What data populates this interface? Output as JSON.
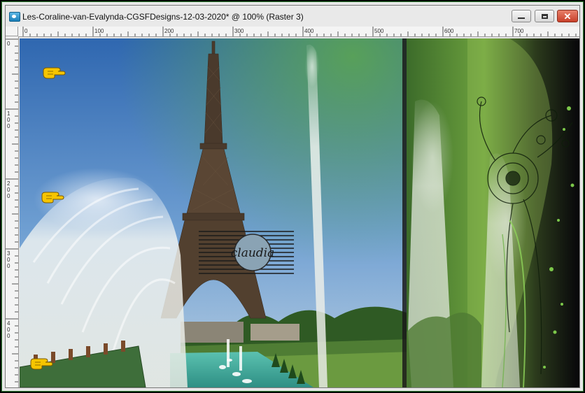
{
  "window": {
    "title": "Les-Coraline-van-Evalynda-CGSFDesigns-12-03-2020* @ 100% (Raster 3)",
    "icon": "psp-image-icon",
    "controls": {
      "minimize_icon": "minimize-icon",
      "maximize_icon": "restore-icon",
      "close_icon": "close-icon",
      "close_glyph": "✕"
    }
  },
  "rulers": {
    "horizontal_labels": [
      "0",
      "100",
      "200",
      "300",
      "400",
      "500",
      "600",
      "700"
    ],
    "vertical_labels": [
      "0",
      "100",
      "200",
      "300",
      "400"
    ]
  },
  "canvas": {
    "watermark_text": "claudia",
    "pointer_hints": [
      "pointing-hand-icon",
      "pointing-hand-icon",
      "pointing-hand-icon"
    ]
  },
  "colors": {
    "sky": "#3a6fb5",
    "green_frame": "#4f8a2a",
    "window_border": "#2e7d32",
    "close_red": "#c8402a"
  }
}
